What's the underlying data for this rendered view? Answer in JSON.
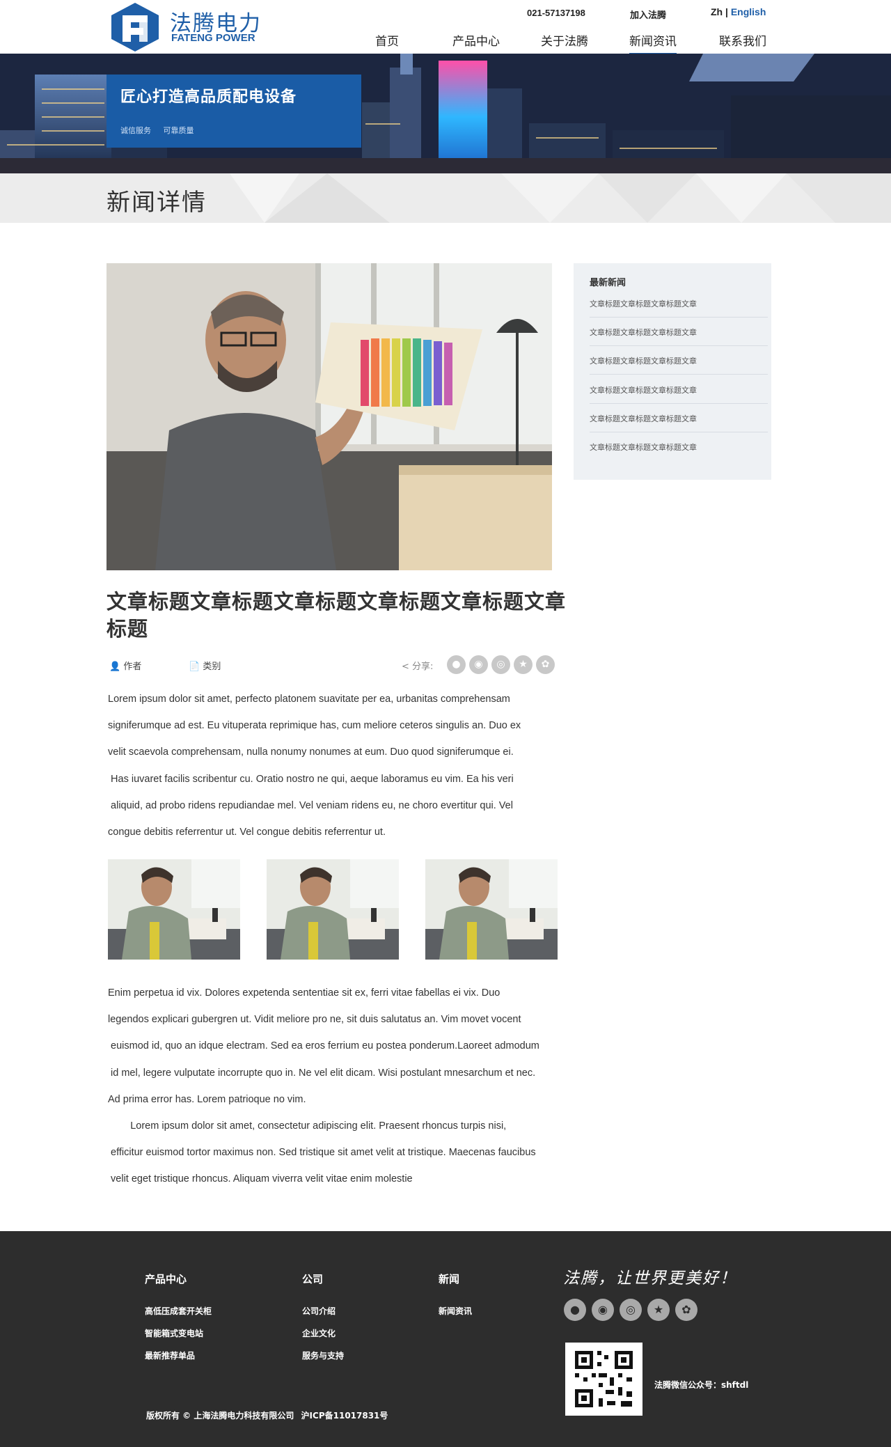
{
  "header": {
    "logo_cn": "法腾电力",
    "logo_en": "FATENG POWER",
    "phone": "021-57137198",
    "join": "加入法腾",
    "lang_zh": "Zh",
    "lang_sep": " | ",
    "lang_en": "English",
    "nav": [
      {
        "label": "首页"
      },
      {
        "label": "产品中心"
      },
      {
        "label": "关于法腾"
      },
      {
        "label": "新闻资讯",
        "active": true
      },
      {
        "label": "联系我们"
      }
    ]
  },
  "banner": {
    "title": "匠心打造高品质配电设备",
    "subs": [
      "诚信服务",
      "可靠质量"
    ]
  },
  "page_title": "新闻详情",
  "article": {
    "title": "文章标题文章标题文章标题文章标题文章标题文章标题",
    "author_label": "作者",
    "category_label": "类别",
    "share_label": "分享:",
    "share_icons": [
      "qq-icon",
      "wechat-icon",
      "weibo-icon",
      "star-icon",
      "baidu-icon"
    ],
    "paragraphs_1": [
      "Lorem ipsum dolor sit amet, perfecto platonem suavitate per ea, urbanitas comprehensam",
      "signiferumque ad est. Eu vituperata reprimique has, cum meliore ceteros singulis an. Duo ex",
      "velit scaevola comprehensam, nulla nonumy nonumes at eum. Duo quod signiferumque ei.",
      " Has iuvaret facilis scribentur cu. Oratio nostro ne qui, aeque laboramus eu vim. Ea his veri",
      " aliquid, ad probo ridens repudiandae mel. Vel veniam ridens eu, ne choro evertitur qui. Vel",
      "congue debitis referrentur ut. Vel congue debitis referrentur ut."
    ],
    "paragraphs_2": [
      "Enim perpetua id vix. Dolores expetenda sententiae sit ex, ferri vitae fabellas ei vix. Duo",
      "legendos explicari gubergren ut. Vidit meliore pro ne, sit duis salutatus an. Vim movet vocent",
      " euismod id, quo an idque electram. Sed ea eros ferrium eu postea ponderum.Laoreet admodum",
      " id mel, legere vulputate incorrupte quo in. Ne vel elit dicam. Wisi postulant mnesarchum et nec.",
      "Ad prima error has. Lorem patrioque no vim.",
      "        Lorem ipsum dolor sit amet, consectetur adipiscing elit. Praesent rhoncus turpis nisi,",
      " efficitur euismod tortor maximus non. Sed tristique sit amet velit at tristique. Maecenas faucibus",
      " velit eget tristique rhoncus. Aliquam viverra velit vitae enim molestie"
    ]
  },
  "sidebar": {
    "title": "最新新闻",
    "items": [
      "文章标题文章标题文章标题文章",
      "文章标题文章标题文章标题文章",
      "文章标题文章标题文章标题文章",
      "文章标题文章标题文章标题文章",
      "文章标题文章标题文章标题文章",
      "文章标题文章标题文章标题文章"
    ]
  },
  "footer": {
    "col1_title": "产品中心",
    "col1_links": [
      "高低压成套开关柜",
      "智能箱式变电站",
      "最新推荐单品"
    ],
    "col2_title": "公司",
    "col2_links": [
      "公司介绍",
      "企业文化",
      "服务与支持"
    ],
    "col3_title": "新闻",
    "col3_links": [
      "新闻资讯"
    ],
    "slogan": "法腾，让世界更美好！",
    "qr_label": "法腾微信公众号：shftdl",
    "copyright": "版权所有 © 上海法腾电力科技有限公司",
    "icp": "沪ICP备11017831号"
  },
  "colors": {
    "brand_blue": "#1f5fa8",
    "footer_bg": "#2d2d2d",
    "sidebar_bg": "#eef1f4"
  }
}
